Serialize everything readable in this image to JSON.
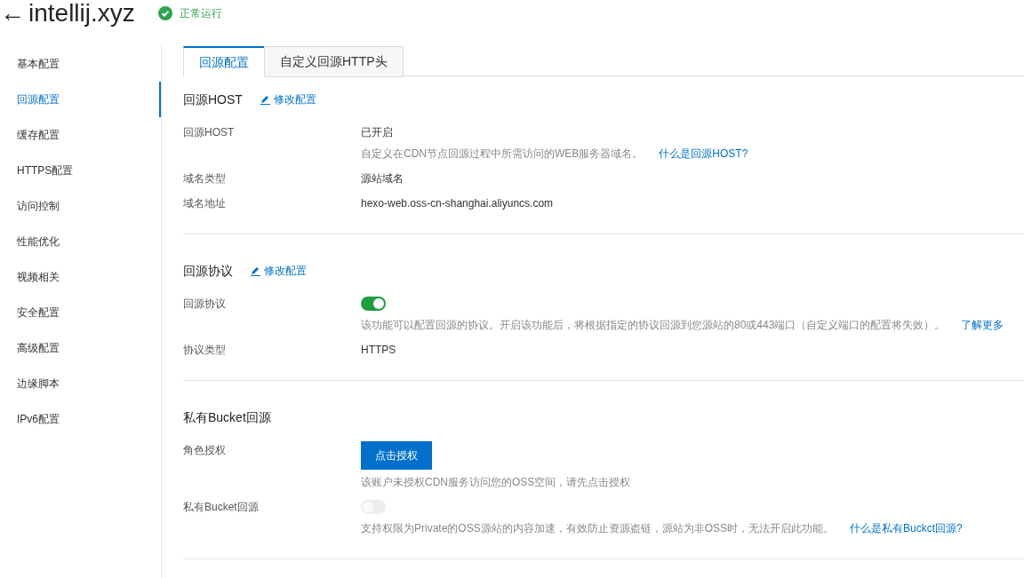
{
  "header": {
    "back": "←",
    "title": "intellij.xyz",
    "status": {
      "text": "正常运行",
      "ok": true
    }
  },
  "sidebar": {
    "items": [
      {
        "label": "基本配置",
        "selected": false
      },
      {
        "label": "回源配置",
        "selected": true
      },
      {
        "label": "缓存配置",
        "selected": false
      },
      {
        "label": "HTTPS配置",
        "selected": false
      },
      {
        "label": "访问控制",
        "selected": false
      },
      {
        "label": "性能优化",
        "selected": false
      },
      {
        "label": "视频相关",
        "selected": false
      },
      {
        "label": "安全配置",
        "selected": false
      },
      {
        "label": "高级配置",
        "selected": false
      },
      {
        "label": "边缘脚本",
        "selected": false
      },
      {
        "label": "IPv6配置",
        "selected": false
      }
    ]
  },
  "tabs": [
    {
      "label": "回源配置",
      "selected": true
    },
    {
      "label": "自定义回源HTTP头",
      "selected": false
    }
  ],
  "sections": [
    {
      "title": "回源HOST",
      "edit_link": "修改配置",
      "rows": [
        {
          "kind": "text",
          "label": "回源HOST",
          "value": "已开启",
          "hint": "自定义在CDN节点回源过程中所需访问的WEB服务器域名。",
          "hint_link": "什么是回源HOST?"
        },
        {
          "kind": "text",
          "label": "域名类型",
          "value": "源站域名"
        },
        {
          "kind": "text",
          "label": "域名地址",
          "value": "hexo-web.oss-cn-shanghai.aliyuncs.com"
        }
      ]
    },
    {
      "title": "回源协议",
      "edit_link": "修改配置",
      "rows": [
        {
          "kind": "toggle",
          "label": "回源协议",
          "on": true,
          "disabled": false,
          "hint": "该功能可以配置回源的协议。开启该功能后，将根据指定的协议回源到您源站的80或443端口（自定义端口的配置将失效）。",
          "hint_link": "了解更多"
        },
        {
          "kind": "text",
          "label": "协议类型",
          "value": "HTTPS"
        }
      ]
    },
    {
      "title": "私有Bucket回源",
      "rows": [
        {
          "kind": "button",
          "label": "角色授权",
          "value": "点击授权",
          "hint": "该账户未授权CDN服务访问您的OSS空间，请先点击授权"
        },
        {
          "kind": "toggle",
          "label": "私有Bucket回源",
          "on": false,
          "disabled": true,
          "hint": "支持权限为Private的OSS源站的内容加速，有效防止资源盗链，源站为非OSS时，无法开启此功能。",
          "hint_link": "什么是私有Buckct回源?"
        }
      ]
    }
  ]
}
